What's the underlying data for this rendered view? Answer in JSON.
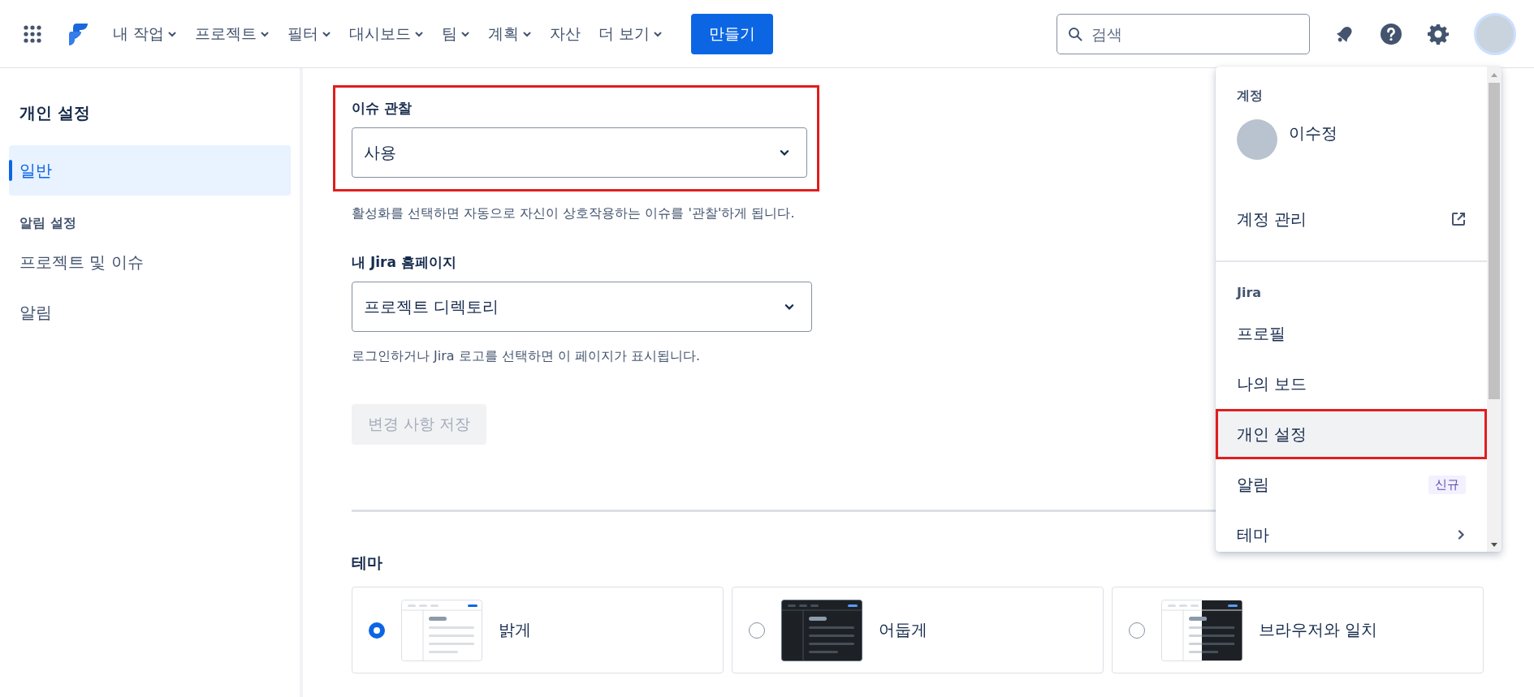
{
  "topbar": {
    "nav": [
      {
        "label": "내 작업",
        "dropdown": true
      },
      {
        "label": "프로젝트",
        "dropdown": true
      },
      {
        "label": "필터",
        "dropdown": true
      },
      {
        "label": "대시보드",
        "dropdown": true
      },
      {
        "label": "팀",
        "dropdown": true
      },
      {
        "label": "계획",
        "dropdown": true
      },
      {
        "label": "자산",
        "dropdown": false
      },
      {
        "label": "더 보기",
        "dropdown": true
      }
    ],
    "create_button": "만들기",
    "search": {
      "placeholder": "검색"
    }
  },
  "sidebar": {
    "title": "개인 설정",
    "items": [
      {
        "kind": "item",
        "label": "일반",
        "selected": true
      },
      {
        "kind": "heading",
        "label": "알림 설정"
      },
      {
        "kind": "item",
        "label": "프로젝트 및 이슈",
        "selected": false
      },
      {
        "kind": "item",
        "label": "알림",
        "selected": false
      }
    ]
  },
  "settings": {
    "fields": [
      {
        "label": "이슈 관찰",
        "value": "사용",
        "help": "활성화를 선택하면 자동으로 자신이 상호작용하는 이슈를 '관찰'하게 됩니다.",
        "highlighted": true
      },
      {
        "label": "내 Jira 홈페이지",
        "value": "프로젝트 디렉토리",
        "help": "로그인하거나 Jira 로고를 선택하면 이 페이지가 표시됩니다.",
        "highlighted": false
      }
    ],
    "save_button": {
      "label": "변경 사항 저장",
      "disabled": true
    },
    "theme": {
      "title": "테마",
      "options": [
        {
          "kind": "light",
          "label": "밝게",
          "selected": true
        },
        {
          "kind": "dark",
          "label": "어둡게",
          "selected": false
        },
        {
          "kind": "system",
          "label": "브라우저와 일치",
          "selected": false
        }
      ]
    }
  },
  "account_menu": {
    "sections": [
      {
        "title": "계정",
        "items": [
          {
            "kind": "profile",
            "label": "이수정",
            "highlighted": false
          },
          {
            "kind": "external",
            "label": "계정 관리",
            "highlighted": false
          }
        ]
      },
      {
        "title": "Jira",
        "items": [
          {
            "kind": "link",
            "label": "프로필",
            "highlighted": false
          },
          {
            "kind": "link",
            "label": "나의 보드",
            "highlighted": false
          },
          {
            "kind": "link",
            "label": "개인 설정",
            "highlighted": true
          },
          {
            "kind": "badge",
            "label": "알림",
            "badge": "신규",
            "highlighted": false
          },
          {
            "kind": "submenu",
            "label": "테마",
            "highlighted": false
          }
        ]
      }
    ]
  }
}
